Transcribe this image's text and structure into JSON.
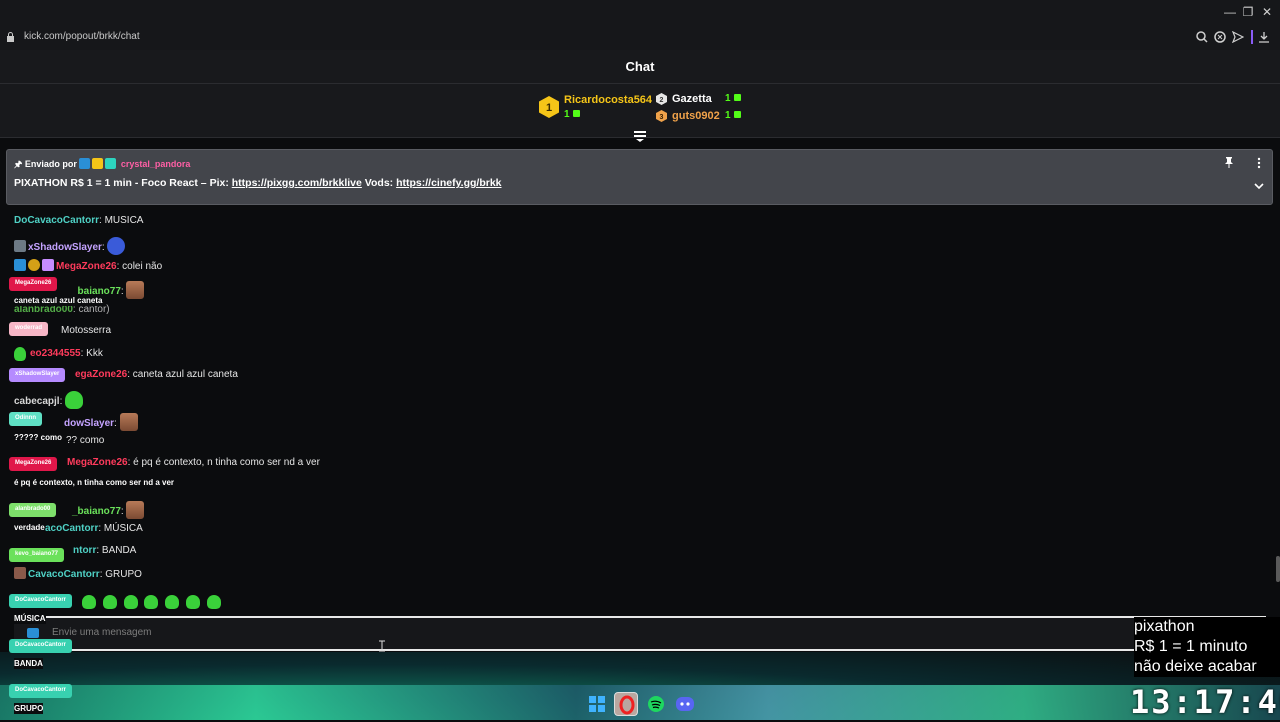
{
  "browser": {
    "url": "kick.com/popout/brkk/chat",
    "controls": {
      "minimize": "—",
      "restore": "❐",
      "close": "✕"
    }
  },
  "chat": {
    "title": "Chat",
    "leaderboard": [
      {
        "rank": "1",
        "name": "Ricardocosta564",
        "count": "1",
        "color": "#f5c518"
      },
      {
        "rank": "2",
        "name": "Gazetta",
        "count": "1",
        "color": "#ffffff"
      },
      {
        "rank": "3",
        "name": "guts0902",
        "count": "1",
        "color": "#f0a24a"
      }
    ],
    "pinned": {
      "sent_by_label": "Enviado por",
      "user": "crystal_pandora",
      "text_prefix": "PIXATHON R$ 1 = 1 min - Foco React – Pix: ",
      "link1": "https://pixgg.com/brkklive",
      "text_mid": " Vods: ",
      "link2": "https://cinefy.gg/brkk"
    },
    "messages": [
      {
        "user": "DoCavacoCantorr",
        "color": "#4fd1c5",
        "text": ": MUSICA"
      },
      {
        "user": "xShadowSlayer",
        "color": "#c4a3ff",
        "text": ":"
      },
      {
        "user": "MegaZone26",
        "color": "#ff3b5c",
        "text": ": colei não"
      },
      {
        "user": "_baiano77",
        "color": "#6be15b",
        "text": ":"
      },
      {
        "user": "alanbrado00",
        "color": "#6be15b",
        "text": ": cantor)"
      },
      {
        "user": "",
        "color": "#ffffff",
        "text": "Motosserra"
      },
      {
        "user": "eo2344555",
        "color": "#ff3b5c",
        "text": ": Kkk"
      },
      {
        "user": "egaZone26",
        "color": "#ff3b5c",
        "text": ": caneta azul azul caneta"
      },
      {
        "user": "cabecapjl",
        "color": "#d8d8d8",
        "text": ":"
      },
      {
        "user": "dowSlayer",
        "color": "#c4a3ff",
        "text": ":"
      },
      {
        "user": "",
        "color": "#ffffff",
        "text": "?? como"
      },
      {
        "user": "MegaZone26",
        "color": "#ff3b5c",
        "text": ": é pq é contexto, n tinha como ser nd a ver"
      },
      {
        "user": "_baiano77",
        "color": "#6be15b",
        "text": ":"
      },
      {
        "user": "acoCantorr",
        "color": "#4fd1c5",
        "text": ": MÚSICA"
      },
      {
        "user": "ntorr",
        "color": "#4fd1c5",
        "text": ": BANDA"
      },
      {
        "user": "CavacoCantorr",
        "color": "#4fd1c5",
        "text": ": GRUPO"
      }
    ],
    "overlays": [
      {
        "tag": "MegaZone26",
        "tag_color": "#e0174a",
        "text": "caneta azul azul caneta"
      },
      {
        "tag": "xShadowSlayer",
        "tag_color": "#b58bff",
        "text": ""
      },
      {
        "tag": "Odinnn",
        "tag_color": "#5fe0c4",
        "text": "????? como"
      },
      {
        "tag": "MegaZone26",
        "tag_color": "#e0174a",
        "text": "é pq é contexto, n tinha como ser nd a ver"
      },
      {
        "tag": "alanbrado00",
        "tag_color": "#7ee06b",
        "text": "verdade"
      },
      {
        "tag": "kevo_baiano77",
        "tag_color": "#6be15b",
        "text": ""
      },
      {
        "tag": "DoCavacoCantorr",
        "tag_color": "#38d1b0",
        "text": "MÚSICA"
      },
      {
        "tag": "DoCavacoCantorr",
        "tag_color": "#38d1b0",
        "text": "BANDA"
      },
      {
        "tag": "DoCavacoCantorr",
        "tag_color": "#38d1b0",
        "text": "GRUPO"
      }
    ],
    "input_placeholder": "Envie uma mensagem"
  },
  "stream_overlay": {
    "promo_line1": "pixathon",
    "promo_line2": "R$ 1 = 1 minuto",
    "promo_line3": "não deixe acabar",
    "clock": "13:17:40"
  },
  "taskbar_icons": [
    "windows-start-icon",
    "opera-icon",
    "spotify-icon",
    "discord-icon"
  ]
}
